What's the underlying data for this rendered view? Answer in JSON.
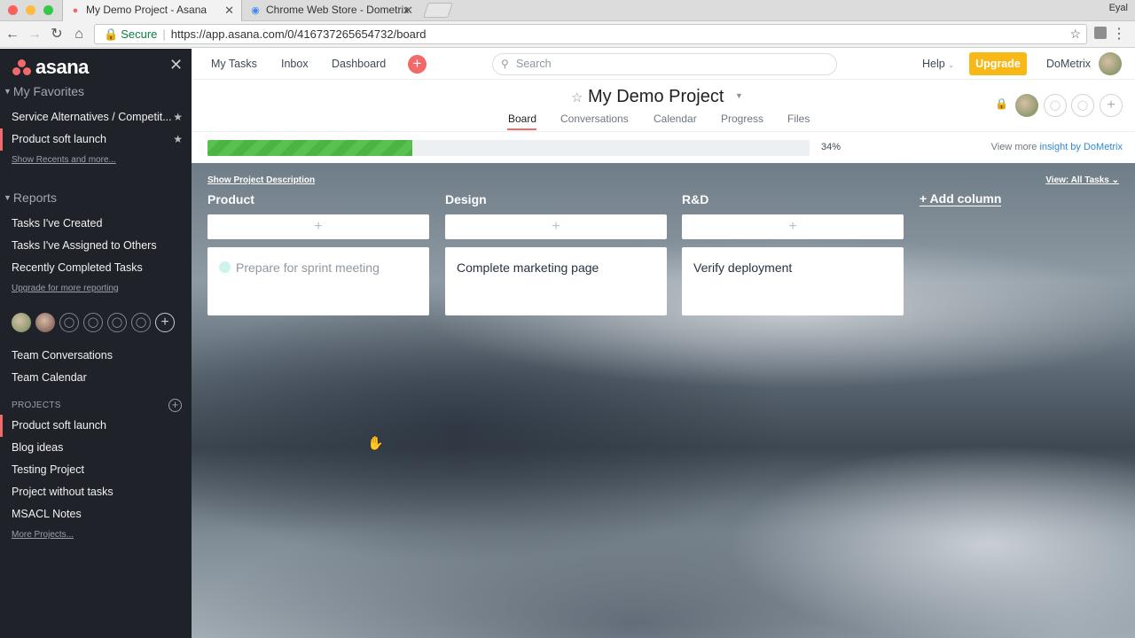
{
  "browser": {
    "tabs": [
      {
        "title": "My Demo Project - Asana",
        "active": true
      },
      {
        "title": "Chrome Web Store - Dometrix",
        "active": false
      }
    ],
    "user": "Eyal",
    "secure_label": "Secure",
    "url": "https://app.asana.com/0/416737265654732/board"
  },
  "sidebar": {
    "logo": "asana",
    "favorites_title": "My Favorites",
    "favorites": [
      {
        "label": "Service Alternatives / Competit..."
      },
      {
        "label": "Product soft launch"
      }
    ],
    "show_recents": "Show Recents and more...",
    "reports_title": "Reports",
    "reports": [
      {
        "label": "Tasks I've Created"
      },
      {
        "label": "Tasks I've Assigned to Others"
      },
      {
        "label": "Recently Completed Tasks"
      }
    ],
    "upgrade_reporting": "Upgrade for more reporting",
    "team_links": [
      {
        "label": "Team Conversations"
      },
      {
        "label": "Team Calendar"
      }
    ],
    "projects_label": "PROJECTS",
    "projects": [
      {
        "label": "Product soft launch"
      },
      {
        "label": "Blog ideas"
      },
      {
        "label": "Testing Project"
      },
      {
        "label": "Project without tasks"
      },
      {
        "label": "MSACL Notes"
      }
    ],
    "more_projects": "More Projects..."
  },
  "topbar": {
    "links": [
      "My Tasks",
      "Inbox",
      "Dashboard"
    ],
    "search_placeholder": "Search",
    "help": "Help",
    "upgrade": "Upgrade",
    "workspace": "DoMetrix"
  },
  "project": {
    "title": "My Demo Project",
    "tabs": [
      "Board",
      "Conversations",
      "Calendar",
      "Progress",
      "Files"
    ],
    "active_tab": "Board",
    "progress": 34,
    "progress_label": "34%",
    "insight_prefix": "View more",
    "insight_link": "insight by DoMetrix"
  },
  "board": {
    "show_description": "Show Project Description",
    "view_filter": "View: All Tasks",
    "add_column": "+ Add column",
    "columns": [
      {
        "title": "Product",
        "cards": [
          "Prepare for sprint meeting"
        ]
      },
      {
        "title": "Design",
        "cards": [
          "Complete marketing page"
        ]
      },
      {
        "title": "R&D",
        "cards": [
          "Verify deployment"
        ]
      }
    ]
  },
  "colors": {
    "accent": "#f06a6a",
    "upgrade": "#f8b818",
    "sidebar_bg": "#1f2229",
    "progress_green": "#5ac04f",
    "link_blue": "#2e8ad8"
  }
}
